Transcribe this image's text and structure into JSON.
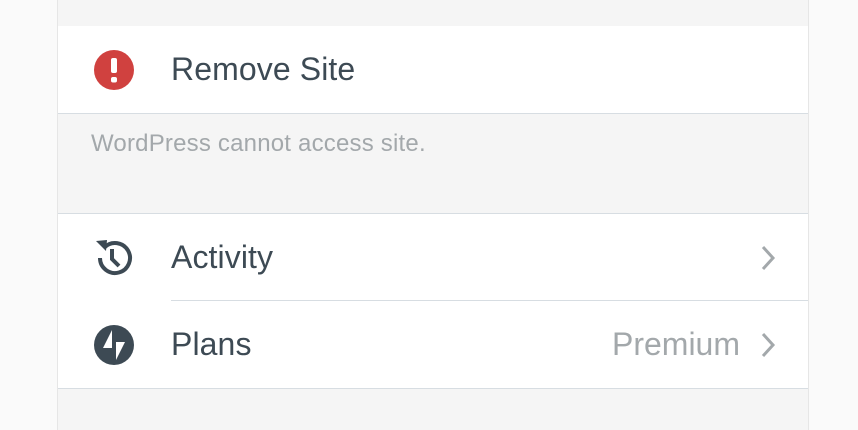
{
  "remove_site": {
    "label": "Remove Site",
    "icon": "alert-icon",
    "icon_color": "#d0413f"
  },
  "notice": {
    "text": "WordPress cannot access site."
  },
  "menu": {
    "items": [
      {
        "label": "Activity",
        "icon": "history-icon",
        "value": ""
      },
      {
        "label": "Plans",
        "icon": "jetpack-bolt-icon",
        "value": "Premium"
      }
    ]
  },
  "colors": {
    "label_text": "#3d4a54",
    "muted_text": "#a3a8ab",
    "divider": "#d7dde2",
    "icon_dark": "#3d4a54"
  }
}
